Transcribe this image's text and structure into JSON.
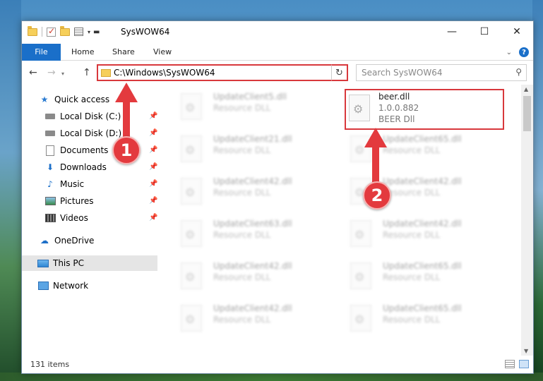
{
  "window": {
    "title": "SysWOW64",
    "controls": {
      "minimize": "—",
      "maximize": "☐",
      "close": "✕"
    }
  },
  "ribbon": {
    "tabs": [
      {
        "label": "File"
      },
      {
        "label": "Home"
      },
      {
        "label": "Share"
      },
      {
        "label": "View"
      }
    ]
  },
  "nav": {
    "address": "C:\\Windows\\SysWOW64",
    "search_placeholder": "Search SysWOW64"
  },
  "sidebar": {
    "items": [
      {
        "label": "Quick access",
        "icon": "star-icon",
        "pinned": false
      },
      {
        "label": "Local Disk (C:)",
        "icon": "disk-icon",
        "pinned": true
      },
      {
        "label": "Local Disk (D:)",
        "icon": "disk-icon",
        "pinned": true
      },
      {
        "label": "Documents",
        "icon": "documents-icon",
        "pinned": true
      },
      {
        "label": "Downloads",
        "icon": "downloads-icon",
        "pinned": true
      },
      {
        "label": "Music",
        "icon": "music-icon",
        "pinned": true
      },
      {
        "label": "Pictures",
        "icon": "pictures-icon",
        "pinned": true
      },
      {
        "label": "Videos",
        "icon": "videos-icon",
        "pinned": true
      },
      {
        "label": "OneDrive",
        "icon": "cloud-icon",
        "pinned": false
      },
      {
        "label": "This PC",
        "icon": "pc-icon",
        "pinned": false,
        "selected": true
      },
      {
        "label": "Network",
        "icon": "network-icon",
        "pinned": false
      }
    ]
  },
  "files": {
    "left_column": [
      {
        "name": "UpdateClient5.dll",
        "type": "Resource DLL"
      },
      {
        "name": "UpdateClient21.dll",
        "type": "Resource DLL"
      },
      {
        "name": "UpdateClient42.dll",
        "type": "Resource DLL"
      },
      {
        "name": "UpdateClient63.dll",
        "type": "Resource DLL"
      },
      {
        "name": "UpdateClient42.dll",
        "type": "Resource DLL"
      },
      {
        "name": "UpdateClient42.dll",
        "type": "Resource DLL"
      }
    ],
    "right_column": [
      {
        "name": "UpdateClient65.dll",
        "type": "Resource DLL"
      },
      {
        "name": "UpdateClient42.dll",
        "type": "Resource DLL"
      },
      {
        "name": "UpdateClient42.dll",
        "type": "Resource DLL"
      },
      {
        "name": "UpdateClient65.dll",
        "type": "Resource DLL"
      },
      {
        "name": "UpdateClient65.dll",
        "type": "Resource DLL"
      }
    ],
    "highlighted": {
      "name": "beer.dll",
      "version": "1.0.0.882",
      "description": "BEER Dll"
    }
  },
  "status": {
    "item_count": "131 items"
  },
  "annotations": {
    "step1": "1",
    "step2": "2",
    "color": "#e33a3e"
  }
}
